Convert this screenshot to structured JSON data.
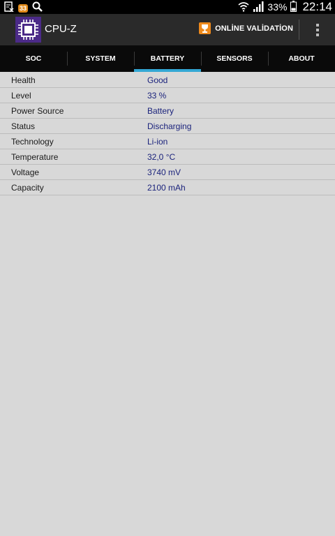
{
  "status_bar": {
    "notification_badge": "33",
    "battery_percent": "33%",
    "time": "22:14",
    "icons": [
      "clipboard-x-icon",
      "badge-icon",
      "search-icon",
      "wifi-icon",
      "signal-icon",
      "battery-icon"
    ]
  },
  "action_bar": {
    "title": "CPU-Z",
    "validation_label": "ONLİNE VALİDATİON",
    "icons": [
      "cpu-chip-icon",
      "trophy-icon",
      "overflow-menu-icon"
    ]
  },
  "tabs": [
    {
      "label": "SOC",
      "active": false
    },
    {
      "label": "SYSTEM",
      "active": false
    },
    {
      "label": "BATTERY",
      "active": true
    },
    {
      "label": "SENSORS",
      "active": false
    },
    {
      "label": "ABOUT",
      "active": false
    }
  ],
  "battery": [
    {
      "label": "Health",
      "value": "Good"
    },
    {
      "label": "Level",
      "value": "33 %"
    },
    {
      "label": "Power Source",
      "value": "Battery"
    },
    {
      "label": "Status",
      "value": "Discharging"
    },
    {
      "label": "Technology",
      "value": "Li-ion"
    },
    {
      "label": "Temperature",
      "value": "32,0 °C"
    },
    {
      "label": "Voltage",
      "value": "3740 mV"
    },
    {
      "label": "Capacity",
      "value": "2100 mAh"
    }
  ],
  "colors": {
    "tab_indicator": "#33a7d4",
    "value_text": "#1b237c",
    "app_icon": "#4b2a88",
    "validation_icon": "#ee8a1c"
  }
}
